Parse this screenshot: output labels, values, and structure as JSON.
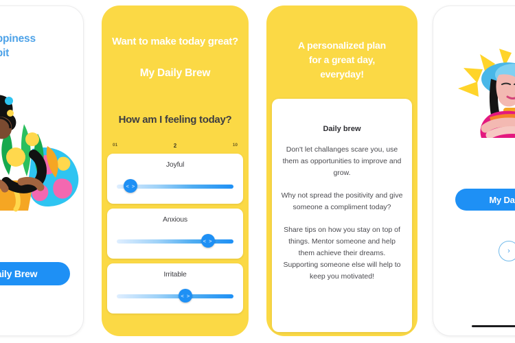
{
  "app": {
    "name": "My Daily Brew",
    "accent_blue": "#1e90f5",
    "accent_yellow": "#fbd945",
    "heading_blue": "#4da2e8"
  },
  "panels": [
    {
      "id": "panel-onboarding-habit",
      "heading": "happiness\nhabit",
      "heading_line1": "happiness",
      "heading_line2": "habit",
      "illustration": "person-holding-plant-pot-illustration",
      "cta_label": "aily Brew"
    },
    {
      "id": "panel-mood-check-in",
      "title": "Want to make today great?",
      "subtitle": "My Daily Brew",
      "question": "How am I feeling today?",
      "scale": {
        "min": "01",
        "mid": "2",
        "max": "10"
      },
      "moods": [
        {
          "label": "Joyful",
          "value": 2,
          "thumb_percent": 12
        },
        {
          "label": "Anxious",
          "value": 8,
          "thumb_percent": 78
        },
        {
          "label": "Irritable",
          "value": 6,
          "thumb_percent": 59
        }
      ],
      "thumb_glyph": "<  >"
    },
    {
      "id": "panel-daily-plan",
      "heading_line1": "A personalized plan",
      "heading_line2": "for a great day,",
      "heading_line3": "everyday!",
      "card_title": "Daily brew",
      "paragraphs": [
        "Don't let challanges scare you, use them as opportunities to improve and grow.",
        "Why not spread the positivity and give someone a compliment today?",
        "Share tips on how you stay on top of things. Mentor someone and help them achieve their dreams. Supporting someone else will help to keep you motivated!"
      ]
    },
    {
      "id": "panel-home",
      "illustration": "woman-crossed-arms-sun-rays-illustration",
      "cta_label": "My Daily",
      "next_glyph": "›"
    }
  ]
}
